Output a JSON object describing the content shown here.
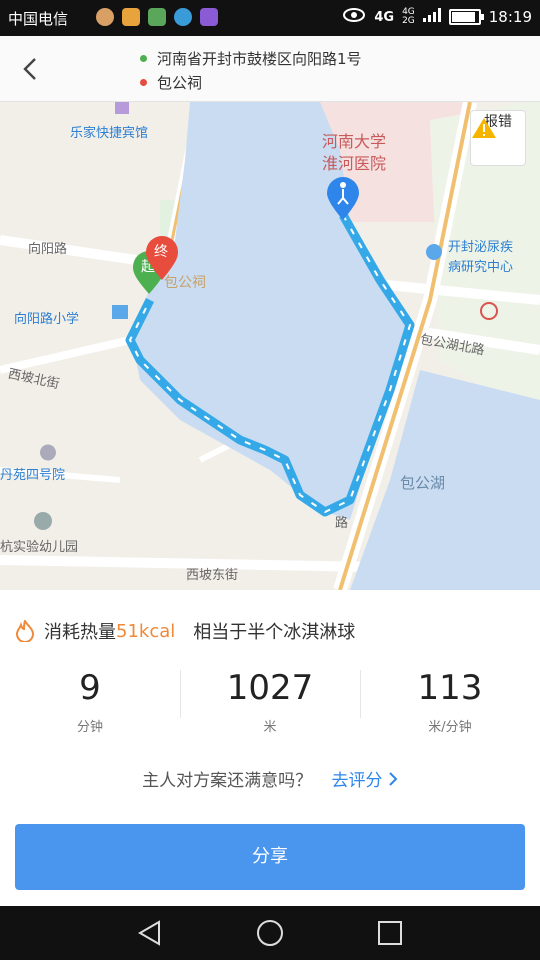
{
  "status_bar": {
    "carrier": "中国电信",
    "network": "4G",
    "network_small": [
      "4G",
      "2G"
    ],
    "time": "18:19",
    "battery_level": 0.9
  },
  "header": {
    "start_address": "河南省开封市鼓楼区向阳路1号",
    "end_address": "包公祠",
    "start_dot_color": "#4caf50",
    "end_dot_color": "#e74c3c"
  },
  "map": {
    "report_label": "报错",
    "pois": {
      "hotel": "乐家快捷宾馆",
      "hospital_line1": "河南大学",
      "hospital_line2": "淮河医院",
      "road_xiangyang": "向阳路",
      "baogong_temple": "包公祠",
      "school": "向阳路小学",
      "hospital2_line1": "开封泌尿疾",
      "hospital2_line2": "病研究中心",
      "road_baogonghu_north": "包公湖北路",
      "road_xipo_north": "西坡北街",
      "residence": "丹苑四号院",
      "kindergarten": "杭实验幼儿园",
      "road_xipo_east": "西坡东街",
      "lake": "包公湖",
      "road_fragment": "路"
    },
    "marker_start": "起",
    "marker_end": "终"
  },
  "stats": {
    "kcal_prefix": "消耗热量",
    "kcal_value": "51kcal",
    "kcal_equiv": "相当于半个冰淇淋球",
    "metrics": [
      {
        "value": "9",
        "unit": "分钟"
      },
      {
        "value": "1027",
        "unit": "米"
      },
      {
        "value": "113",
        "unit": "米/分钟"
      }
    ],
    "feedback_question": "主人对方案还满意吗？",
    "feedback_link": "去评分",
    "share_label": "分享"
  },
  "colors": {
    "accent": "#4a95ee",
    "kcal": "#f08a3a",
    "route": "#35a9e8",
    "lake": "#c9dcf2"
  }
}
